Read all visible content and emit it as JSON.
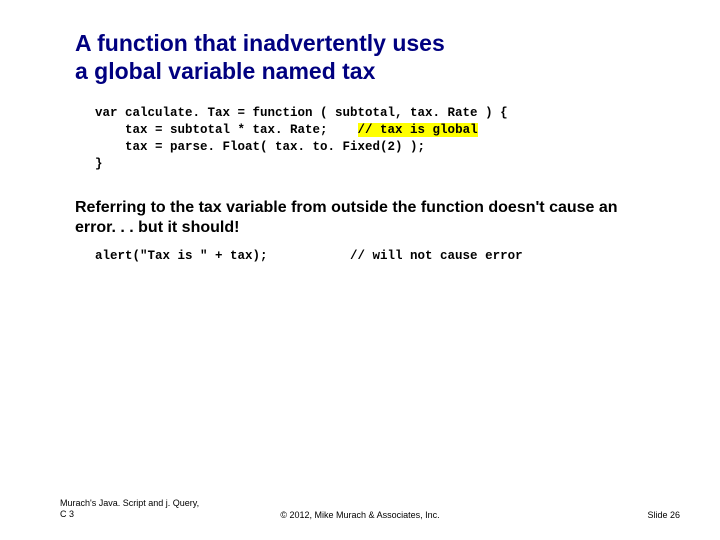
{
  "title_line1": "A function that inadvertently uses",
  "title_line2": "a global variable named tax",
  "code1": {
    "l1": "var calculate. Tax = function ( subtotal, tax. Rate ) {",
    "l2a": "    tax = subtotal * tax. Rate;    ",
    "l2b": "// tax is global",
    "l3": "    tax = parse. Float( tax. to. Fixed(2) );",
    "l4": "}"
  },
  "subheading": "Referring to the tax variable from outside the function doesn't cause an error. . . but it should!",
  "code2": {
    "l1": "alert(\"Tax is \" + tax);           // will not cause error"
  },
  "footer": {
    "left_line1": "Murach's Java. Script and j. Query,",
    "left_line2": "C 3",
    "center": "© 2012, Mike Murach & Associates, Inc.",
    "right": "Slide 26"
  }
}
